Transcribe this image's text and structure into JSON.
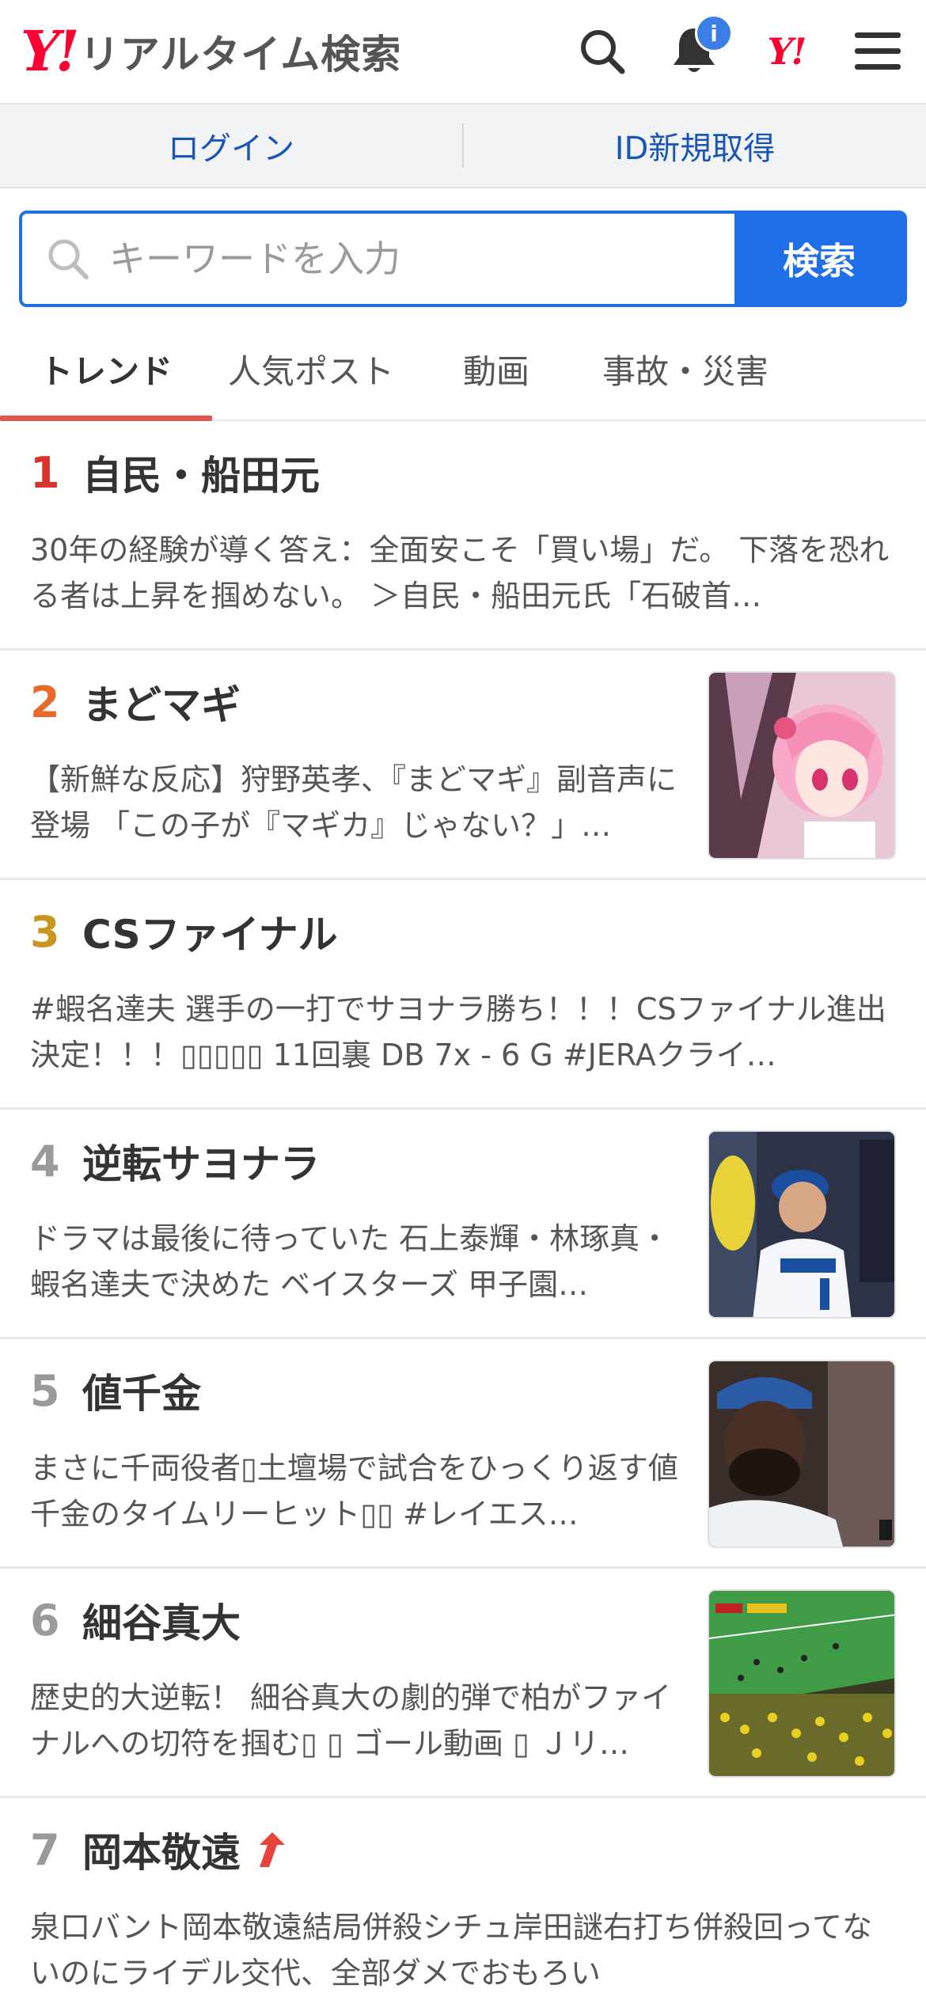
{
  "header": {
    "logo_mark": "Y!",
    "logo_text": "リアルタイム検索",
    "notification_badge": "i",
    "yahoo_mini": "Y!"
  },
  "login_bar": {
    "login_label": "ログイン",
    "signup_label": "ID新規取得"
  },
  "search": {
    "placeholder": "キーワードを入力",
    "button_label": "検索"
  },
  "tabs": [
    {
      "label": "トレンド",
      "active": true
    },
    {
      "label": "人気ポスト",
      "active": false
    },
    {
      "label": "動画",
      "active": false
    },
    {
      "label": "事故・災害",
      "active": false
    }
  ],
  "rank_colors": {
    "1": "#d9342b",
    "2": "#e8692a",
    "3": "#c8961e",
    "default": "#9a9a9a"
  },
  "trends": [
    {
      "rank": "1",
      "title": "自民・船田元",
      "snippet": "30年の経験が導く答え：全面安こそ「買い場」だ。 下落を恐れる者は上昇を掴めない。 ＞自民・船田元氏「石破首…",
      "thumb": null
    },
    {
      "rank": "2",
      "title": "まどマギ",
      "snippet": "【新鮮な反応】狩野英孝、『まどマギ』副音声に登場 「この子が『マギカ』じゃない？」…",
      "thumb": "anime"
    },
    {
      "rank": "3",
      "title": "CSファイナル",
      "snippet": "#蝦名達夫 選手の一打でサヨナラ勝ち！！！CSファイナル進出決定！！！▯▯▯▯▯ 11回裏 DB 7x - 6 G #JERAクライ…",
      "thumb": null
    },
    {
      "rank": "4",
      "title": "逆転サヨナラ",
      "snippet": "ドラマは最後に待っていた 石上泰輝・林琢真・蝦名達夫で決めた ベイスターズ 甲子園…",
      "thumb": "baseball-coach"
    },
    {
      "rank": "5",
      "title": "値千金",
      "snippet": "まさに千両役者▯土壇場で試合をひっくり返す値千金のタイムリーヒット▯▯ #レイエス…",
      "thumb": "baseball-player"
    },
    {
      "rank": "6",
      "title": "細谷真大",
      "snippet": "歴史的大逆転！ 細谷真大の劇的弾で柏がファイナルへの切符を掴む▯ ▯ ゴール動画 ▯ Ｊリ…",
      "thumb": "soccer"
    },
    {
      "rank": "7",
      "title": "岡本敬遠",
      "snippet": "泉口バント岡本敬遠結局併殺シチュ岸田謎右打ち併殺回ってないのにライデル交代、全部ダメでおもろい",
      "thumb": null,
      "trending_up": true
    }
  ]
}
